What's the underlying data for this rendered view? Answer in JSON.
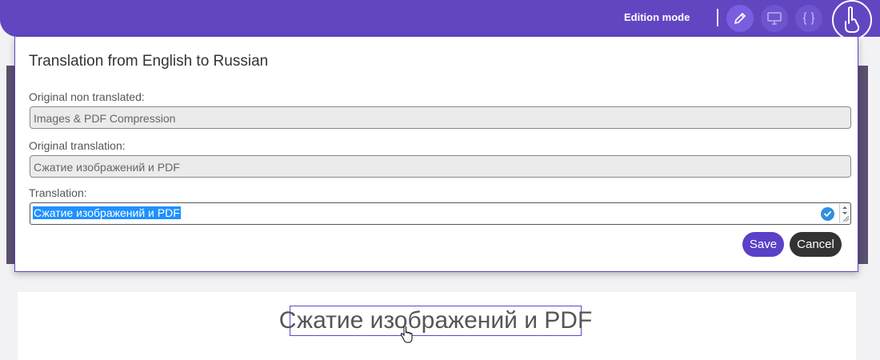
{
  "topbar": {
    "mode_label": "Edition mode",
    "buttons": [
      {
        "icon": "pencil-icon",
        "active": true
      },
      {
        "icon": "monitor-icon",
        "active": false
      },
      {
        "icon": "braces-icon",
        "active": false
      }
    ],
    "logo_icon": "hand-logo-icon"
  },
  "modal": {
    "title": "Translation from English to Russian",
    "original_label": "Original non translated:",
    "original_value": "Images & PDF Compression",
    "original_translation_label": "Original translation:",
    "original_translation_value": "Сжатие изображений и PDF",
    "translation_label": "Translation:",
    "translation_value": "Сжатие изображений и PDF",
    "save_label": "Save",
    "cancel_label": "Cancel"
  },
  "page": {
    "heading": "Сжатие изображений и PDF"
  },
  "colors": {
    "brand": "#6246c1",
    "save": "#5b40c8",
    "cancel": "#333333",
    "selection": "#1e90ff"
  }
}
